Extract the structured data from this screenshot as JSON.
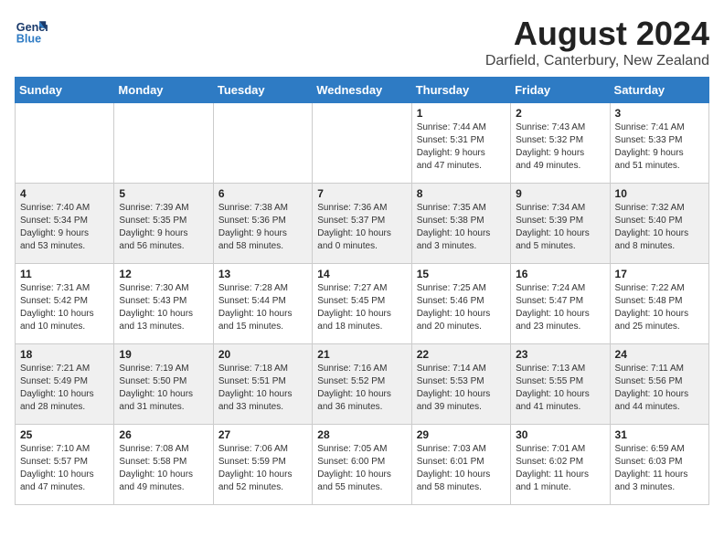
{
  "header": {
    "logo_line1": "General",
    "logo_line2": "Blue",
    "month": "August 2024",
    "location": "Darfield, Canterbury, New Zealand"
  },
  "weekdays": [
    "Sunday",
    "Monday",
    "Tuesday",
    "Wednesday",
    "Thursday",
    "Friday",
    "Saturday"
  ],
  "weeks": [
    [
      {
        "day": "",
        "info": ""
      },
      {
        "day": "",
        "info": ""
      },
      {
        "day": "",
        "info": ""
      },
      {
        "day": "",
        "info": ""
      },
      {
        "day": "1",
        "info": "Sunrise: 7:44 AM\nSunset: 5:31 PM\nDaylight: 9 hours\nand 47 minutes."
      },
      {
        "day": "2",
        "info": "Sunrise: 7:43 AM\nSunset: 5:32 PM\nDaylight: 9 hours\nand 49 minutes."
      },
      {
        "day": "3",
        "info": "Sunrise: 7:41 AM\nSunset: 5:33 PM\nDaylight: 9 hours\nand 51 minutes."
      }
    ],
    [
      {
        "day": "4",
        "info": "Sunrise: 7:40 AM\nSunset: 5:34 PM\nDaylight: 9 hours\nand 53 minutes."
      },
      {
        "day": "5",
        "info": "Sunrise: 7:39 AM\nSunset: 5:35 PM\nDaylight: 9 hours\nand 56 minutes."
      },
      {
        "day": "6",
        "info": "Sunrise: 7:38 AM\nSunset: 5:36 PM\nDaylight: 9 hours\nand 58 minutes."
      },
      {
        "day": "7",
        "info": "Sunrise: 7:36 AM\nSunset: 5:37 PM\nDaylight: 10 hours\nand 0 minutes."
      },
      {
        "day": "8",
        "info": "Sunrise: 7:35 AM\nSunset: 5:38 PM\nDaylight: 10 hours\nand 3 minutes."
      },
      {
        "day": "9",
        "info": "Sunrise: 7:34 AM\nSunset: 5:39 PM\nDaylight: 10 hours\nand 5 minutes."
      },
      {
        "day": "10",
        "info": "Sunrise: 7:32 AM\nSunset: 5:40 PM\nDaylight: 10 hours\nand 8 minutes."
      }
    ],
    [
      {
        "day": "11",
        "info": "Sunrise: 7:31 AM\nSunset: 5:42 PM\nDaylight: 10 hours\nand 10 minutes."
      },
      {
        "day": "12",
        "info": "Sunrise: 7:30 AM\nSunset: 5:43 PM\nDaylight: 10 hours\nand 13 minutes."
      },
      {
        "day": "13",
        "info": "Sunrise: 7:28 AM\nSunset: 5:44 PM\nDaylight: 10 hours\nand 15 minutes."
      },
      {
        "day": "14",
        "info": "Sunrise: 7:27 AM\nSunset: 5:45 PM\nDaylight: 10 hours\nand 18 minutes."
      },
      {
        "day": "15",
        "info": "Sunrise: 7:25 AM\nSunset: 5:46 PM\nDaylight: 10 hours\nand 20 minutes."
      },
      {
        "day": "16",
        "info": "Sunrise: 7:24 AM\nSunset: 5:47 PM\nDaylight: 10 hours\nand 23 minutes."
      },
      {
        "day": "17",
        "info": "Sunrise: 7:22 AM\nSunset: 5:48 PM\nDaylight: 10 hours\nand 25 minutes."
      }
    ],
    [
      {
        "day": "18",
        "info": "Sunrise: 7:21 AM\nSunset: 5:49 PM\nDaylight: 10 hours\nand 28 minutes."
      },
      {
        "day": "19",
        "info": "Sunrise: 7:19 AM\nSunset: 5:50 PM\nDaylight: 10 hours\nand 31 minutes."
      },
      {
        "day": "20",
        "info": "Sunrise: 7:18 AM\nSunset: 5:51 PM\nDaylight: 10 hours\nand 33 minutes."
      },
      {
        "day": "21",
        "info": "Sunrise: 7:16 AM\nSunset: 5:52 PM\nDaylight: 10 hours\nand 36 minutes."
      },
      {
        "day": "22",
        "info": "Sunrise: 7:14 AM\nSunset: 5:53 PM\nDaylight: 10 hours\nand 39 minutes."
      },
      {
        "day": "23",
        "info": "Sunrise: 7:13 AM\nSunset: 5:55 PM\nDaylight: 10 hours\nand 41 minutes."
      },
      {
        "day": "24",
        "info": "Sunrise: 7:11 AM\nSunset: 5:56 PM\nDaylight: 10 hours\nand 44 minutes."
      }
    ],
    [
      {
        "day": "25",
        "info": "Sunrise: 7:10 AM\nSunset: 5:57 PM\nDaylight: 10 hours\nand 47 minutes."
      },
      {
        "day": "26",
        "info": "Sunrise: 7:08 AM\nSunset: 5:58 PM\nDaylight: 10 hours\nand 49 minutes."
      },
      {
        "day": "27",
        "info": "Sunrise: 7:06 AM\nSunset: 5:59 PM\nDaylight: 10 hours\nand 52 minutes."
      },
      {
        "day": "28",
        "info": "Sunrise: 7:05 AM\nSunset: 6:00 PM\nDaylight: 10 hours\nand 55 minutes."
      },
      {
        "day": "29",
        "info": "Sunrise: 7:03 AM\nSunset: 6:01 PM\nDaylight: 10 hours\nand 58 minutes."
      },
      {
        "day": "30",
        "info": "Sunrise: 7:01 AM\nSunset: 6:02 PM\nDaylight: 11 hours\nand 1 minute."
      },
      {
        "day": "31",
        "info": "Sunrise: 6:59 AM\nSunset: 6:03 PM\nDaylight: 11 hours\nand 3 minutes."
      }
    ]
  ],
  "accent_color": "#2e7bc4"
}
